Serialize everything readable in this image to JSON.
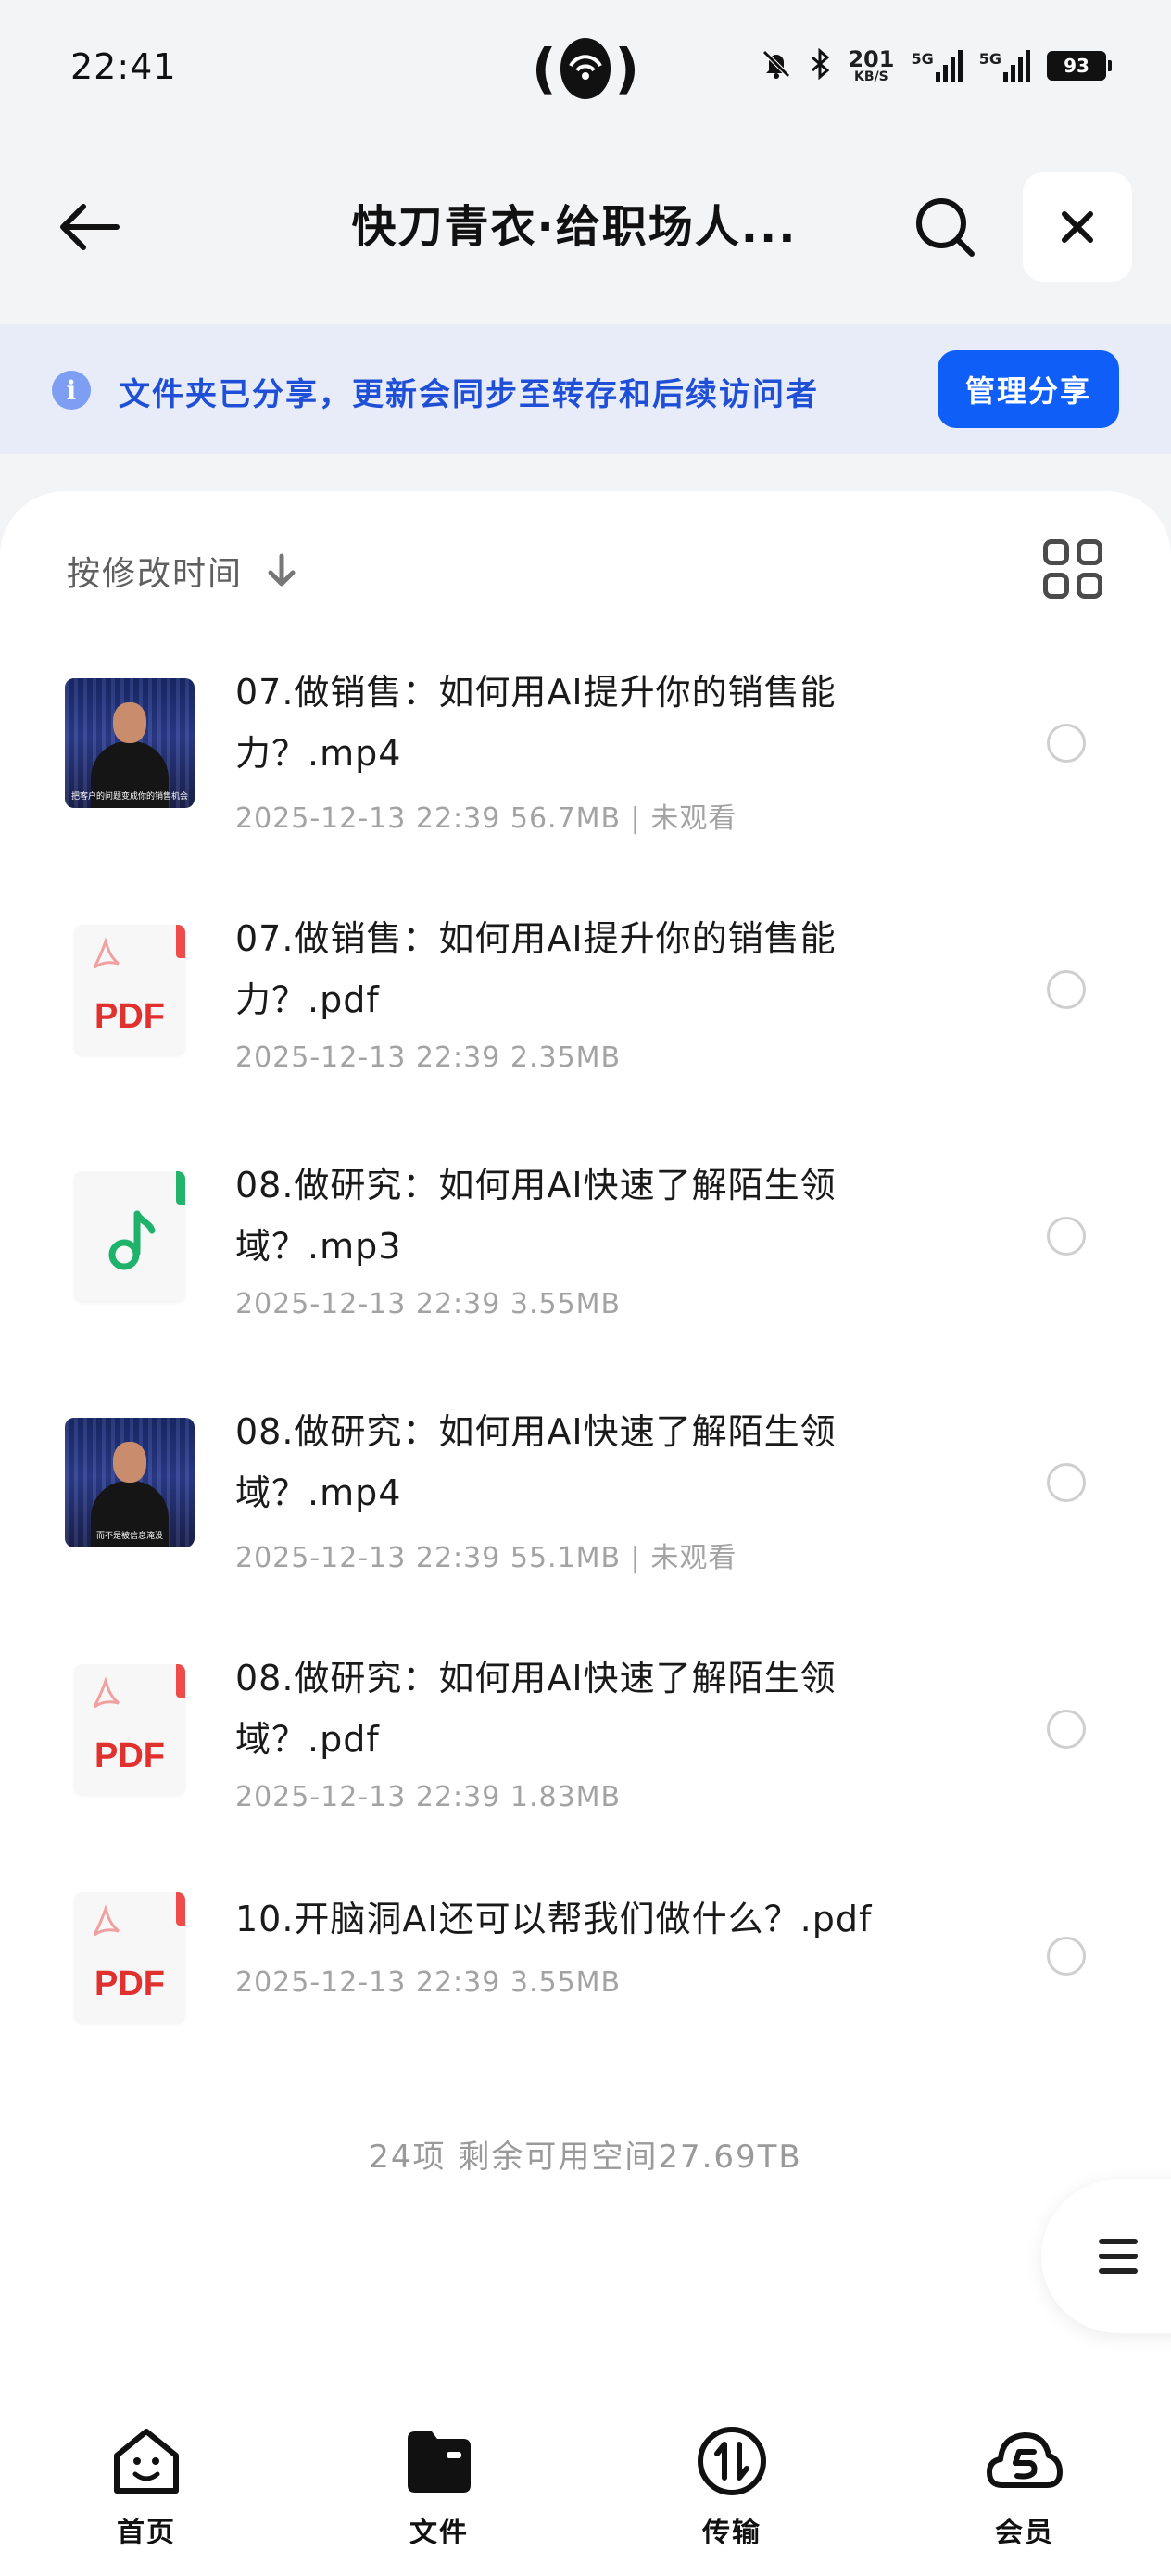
{
  "status_bar": {
    "time": "22:41",
    "net_speed": "201",
    "net_unit": "KB/S",
    "net1": "5G",
    "net2": "5G",
    "battery": "93"
  },
  "header": {
    "title": "快刀青衣·给职场人...",
    "back_icon": "arrow-left-icon",
    "search_icon": "search-icon",
    "close_icon": "close-icon"
  },
  "banner": {
    "info_icon": "info-icon",
    "info_glyph": "i",
    "text": "文件夹已分享，更新会同步至转存和后续访问者",
    "manage_button": "管理分享"
  },
  "sort": {
    "label": "按修改时间",
    "arrow_icon": "arrow-down-icon",
    "view_icon": "grid-view-icon"
  },
  "files": [
    {
      "type": "video",
      "name": "07.做销售：如何用AI提升你的销售能力？.mp4",
      "meta": "2025-12-13 22:39  56.7MB | 未观看",
      "thumb_caption": "把客户的问题变成你的销售机会"
    },
    {
      "type": "pdf",
      "name": "07.做销售：如何用AI提升你的销售能力？.pdf",
      "meta": "2025-12-13 22:39  2.35MB",
      "badge": "PDF"
    },
    {
      "type": "audio",
      "name": "08.做研究：如何用AI快速了解陌生领域？.mp3",
      "meta": "2025-12-13 22:39  3.55MB"
    },
    {
      "type": "video",
      "name": "08.做研究：如何用AI快速了解陌生领域？.mp4",
      "meta": "2025-12-13 22:39  55.1MB | 未观看",
      "thumb_caption": "而不是被信息淹没"
    },
    {
      "type": "pdf",
      "name": "08.做研究：如何用AI快速了解陌生领域？.pdf",
      "meta": "2025-12-13 22:39  1.83MB",
      "badge": "PDF"
    },
    {
      "type": "pdf",
      "name": "10.开脑洞AI还可以帮我们做什么？.pdf",
      "meta": "2025-12-13 22:39  3.55MB",
      "badge": "PDF"
    }
  ],
  "footer": {
    "count_text": "24项 剩余可用空间27.69TB"
  },
  "float_menu": {
    "icon": "menu-icon"
  },
  "bottom_nav": [
    {
      "label": "首页",
      "icon": "home-face-icon"
    },
    {
      "label": "文件",
      "icon": "folder-icon"
    },
    {
      "label": "传输",
      "icon": "transfer-icon"
    },
    {
      "label": "会员",
      "icon": "vip-cloud-icon"
    }
  ]
}
